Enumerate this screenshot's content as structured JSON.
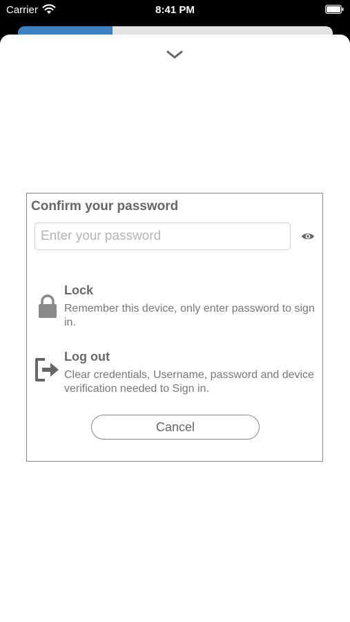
{
  "status_bar": {
    "carrier": "Carrier",
    "time": "8:41 PM"
  },
  "background_progress": 0.3,
  "colors": {
    "progress": "#3a82c4",
    "sheet": "#ffffff",
    "text_gray": "#666666",
    "border": "#8a8a8a"
  },
  "dialog": {
    "title": "Confirm your password",
    "password_placeholder": "Enter your password",
    "password_value": "",
    "show_password_icon": "eye-icon",
    "options": [
      {
        "icon": "lock-icon",
        "title": "Lock",
        "description": "Remember this device, only enter password to sign in."
      },
      {
        "icon": "logout-icon",
        "title": "Log out",
        "description": "Clear credentials, Username, password and device verification needed to Sign in."
      }
    ],
    "cancel_label": "Cancel"
  }
}
